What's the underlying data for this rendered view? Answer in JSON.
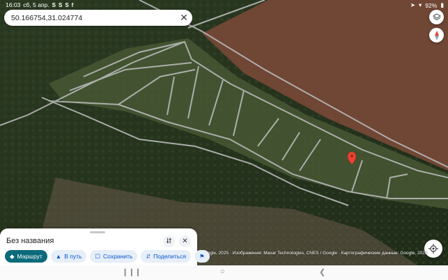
{
  "status_bar": {
    "time": "16:03",
    "date": "сб, 5 апр.",
    "notif_icons": [
      "S",
      "S",
      "S",
      "f"
    ],
    "battery": "92%"
  },
  "search": {
    "query": "50.166754,31.024774"
  },
  "place_sheet": {
    "title": "Без названия",
    "actions": {
      "route": "Маршрут",
      "start": "В путь",
      "save": "Сохранить",
      "share": "Поделиться"
    }
  },
  "attribution": "Google, 2025 · Изображения: Maxar Technologies, CNES / Google · Картографические данные: Google, 2025",
  "colors": {
    "route_chip": "#0b6b7a",
    "chip_bg": "#e6eef8",
    "chip_text": "#0b57d0",
    "pin": "#ea4335"
  }
}
